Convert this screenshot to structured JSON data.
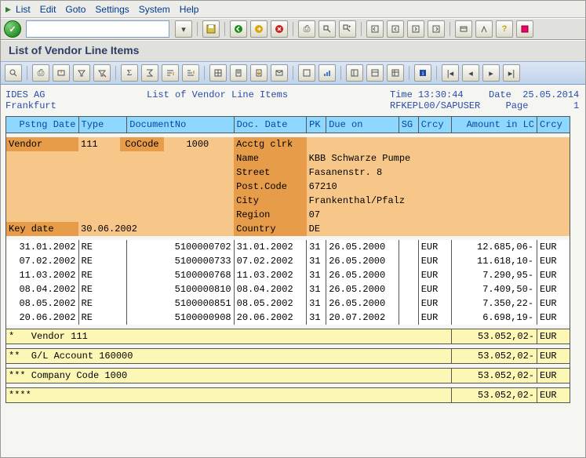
{
  "menu": {
    "list": "List",
    "edit": "Edit",
    "goto": "Goto",
    "settings": "Settings",
    "system": "System",
    "help": "Help"
  },
  "title": "List of Vendor Line Items",
  "header": {
    "company": "IDES AG",
    "city": "Frankfurt",
    "report_title": "List of Vendor Line Items",
    "time_lbl": "Time",
    "time": "13:30:44",
    "prog": "RFKEPL00/SAPUSER",
    "date_lbl": "Date",
    "date": "25.05.2014",
    "page_lbl": "Page",
    "page": "1"
  },
  "cols": {
    "pstng": "Pstng Date",
    "type": "Type",
    "doc": "DocumentNo",
    "ddate": "Doc. Date",
    "pk": "PK",
    "due": "Due on",
    "sg": "SG",
    "crcy": "Crcy",
    "amt": "Amount in LC",
    "crcy2": "Crcy"
  },
  "info": {
    "vendor_lbl": "Vendor",
    "vendor": "111",
    "cocode_lbl": "CoCode",
    "cocode": "1000",
    "ac_lbl": "Acctg clrk",
    "name_lbl": "Name",
    "name": "KBB Schwarze Pumpe",
    "street_lbl": "Street",
    "street": "Fasanenstr. 8",
    "post_lbl": "Post.Code",
    "post": "67210",
    "city_lbl": "City",
    "city": "Frankenthal/Pfalz",
    "region_lbl": "Region",
    "region": "07",
    "keydate_lbl": "Key date",
    "keydate": "30.06.2002",
    "country_lbl": "Country",
    "country": "DE"
  },
  "rows": [
    {
      "pd": "31.01.2002",
      "ty": "RE",
      "dn": "5100000702",
      "dd": "31.01.2002",
      "pk": "31",
      "du": "26.05.2000",
      "cr": "EUR",
      "am": "12.685,06-",
      "cr2": "EUR"
    },
    {
      "pd": "07.02.2002",
      "ty": "RE",
      "dn": "5100000733",
      "dd": "07.02.2002",
      "pk": "31",
      "du": "26.05.2000",
      "cr": "EUR",
      "am": "11.618,10-",
      "cr2": "EUR"
    },
    {
      "pd": "11.03.2002",
      "ty": "RE",
      "dn": "5100000768",
      "dd": "11.03.2002",
      "pk": "31",
      "du": "26.05.2000",
      "cr": "EUR",
      "am": "7.290,95-",
      "cr2": "EUR"
    },
    {
      "pd": "08.04.2002",
      "ty": "RE",
      "dn": "5100000810",
      "dd": "08.04.2002",
      "pk": "31",
      "du": "26.05.2000",
      "cr": "EUR",
      "am": "7.409,50-",
      "cr2": "EUR"
    },
    {
      "pd": "08.05.2002",
      "ty": "RE",
      "dn": "5100000851",
      "dd": "08.05.2002",
      "pk": "31",
      "du": "26.05.2000",
      "cr": "EUR",
      "am": "7.350,22-",
      "cr2": "EUR"
    },
    {
      "pd": "20.06.2002",
      "ty": "RE",
      "dn": "5100000908",
      "dd": "20.06.2002",
      "pk": "31",
      "du": "20.07.2002",
      "cr": "EUR",
      "am": "6.698,19-",
      "cr2": "EUR"
    }
  ],
  "totals": [
    {
      "label": "*   Vendor 111",
      "amt": "53.052,02-",
      "cr": "EUR"
    },
    {
      "label": "**  G/L Account 160000",
      "amt": "53.052,02-",
      "cr": "EUR"
    },
    {
      "label": "*** Company Code 1000",
      "amt": "53.052,02-",
      "cr": "EUR"
    },
    {
      "label": "****",
      "amt": "53.052,02-",
      "cr": "EUR"
    }
  ]
}
